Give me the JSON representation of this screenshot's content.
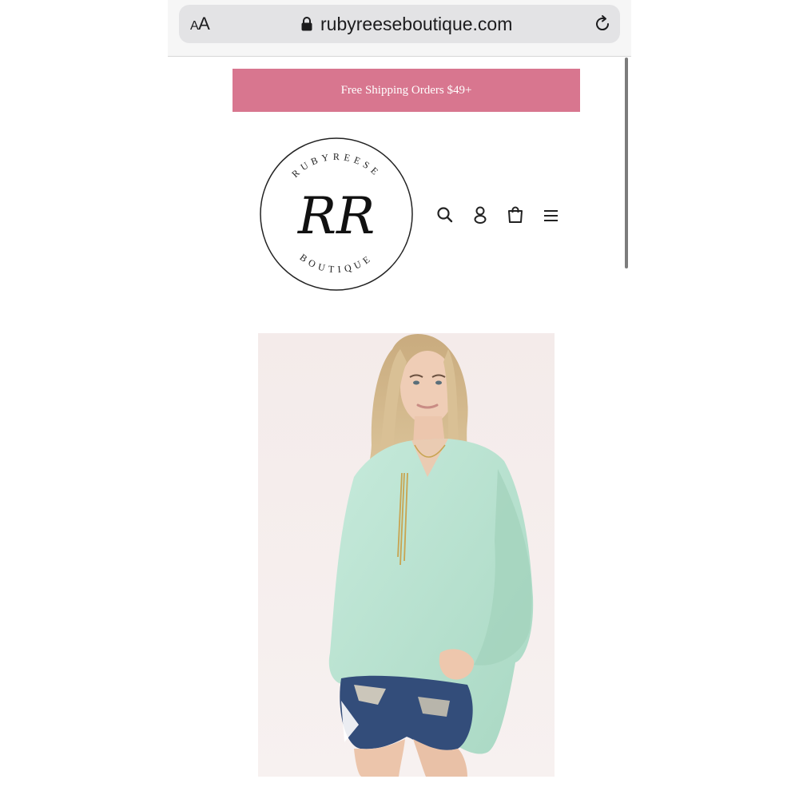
{
  "browser": {
    "text_size_label": "AA",
    "url": "rubyreeseboutique.com"
  },
  "announcement": {
    "text": "Free Shipping Orders $49+"
  },
  "logo": {
    "top_text": "RUBYREESE",
    "monogram": "RR",
    "bottom_text": "BOUTIQUE"
  },
  "header": {
    "icons": [
      "search-icon",
      "account-icon",
      "cart-icon",
      "menu-icon"
    ]
  },
  "product": {
    "image": "model-in-mint-sweater"
  },
  "colors": {
    "announcement_bg": "#d8768f",
    "sweater": "#b9e2d0"
  }
}
